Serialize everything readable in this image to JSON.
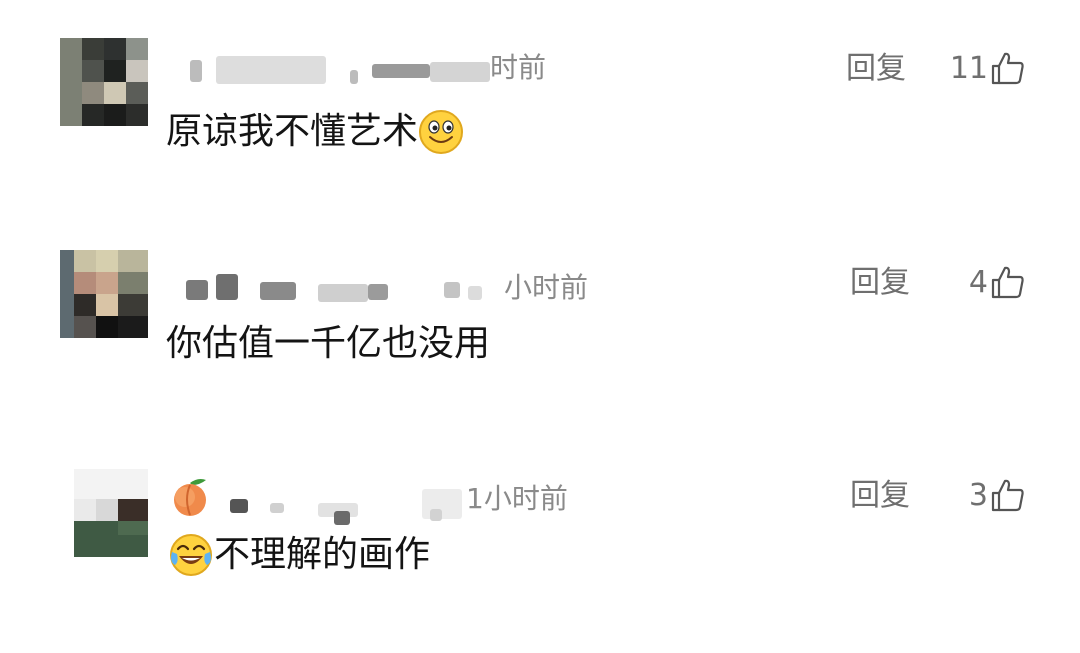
{
  "comments": [
    {
      "time": "时前",
      "text": "原谅我不懂艺术",
      "emoji": "smiling-face-emoji",
      "reply_label": "回复",
      "likes": "11"
    },
    {
      "time": "小时前",
      "text": "你估值一千亿也没用",
      "reply_label": "回复",
      "likes": "4"
    },
    {
      "time": "1小时前",
      "badge": "peach-emoji",
      "lead_emoji": "tears-of-joy-emoji",
      "text": "不理解的画作",
      "reply_label": "回复",
      "likes": "3"
    }
  ],
  "colors": {
    "meta_text": "#8a8a8a",
    "action_text": "#6f6f6f",
    "body_text": "#141414"
  }
}
